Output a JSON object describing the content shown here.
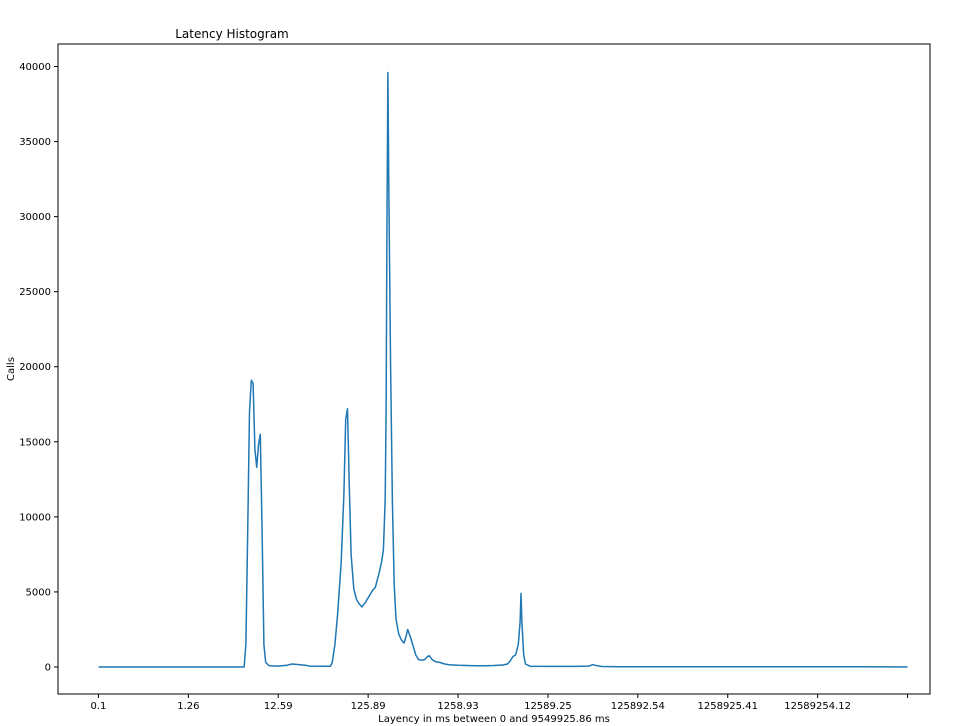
{
  "chart_data": {
    "type": "line",
    "title": "Latency Histogram",
    "xlabel": "Layency in ms between 0 and 9549925.86 ms",
    "ylabel": "Calls",
    "x_tick_labels": [
      "0.1",
      "1.26",
      "12.59",
      "125.89",
      "1258.93",
      "12589.25",
      "125892.54",
      "1258925.41",
      "12589254.12",
      ""
    ],
    "y_ticks": [
      0,
      5000,
      10000,
      15000,
      20000,
      25000,
      30000,
      35000,
      40000
    ],
    "ylim": [
      -1800,
      41500
    ],
    "xlim": [
      -0.45,
      9.25
    ],
    "grid": false,
    "legend": "none",
    "series": [
      {
        "color": "#1f77b4",
        "points": [
          [
            0.0,
            0
          ],
          [
            1.0,
            0
          ],
          [
            1.5,
            0
          ],
          [
            1.58,
            0
          ],
          [
            1.62,
            0
          ],
          [
            1.64,
            1500
          ],
          [
            1.66,
            9000
          ],
          [
            1.68,
            17000
          ],
          [
            1.7,
            19100
          ],
          [
            1.72,
            18900
          ],
          [
            1.74,
            14500
          ],
          [
            1.76,
            13300
          ],
          [
            1.78,
            14800
          ],
          [
            1.8,
            15500
          ],
          [
            1.82,
            9000
          ],
          [
            1.84,
            1500
          ],
          [
            1.86,
            300
          ],
          [
            1.9,
            80
          ],
          [
            2.0,
            60
          ],
          [
            2.1,
            120
          ],
          [
            2.15,
            200
          ],
          [
            2.2,
            170
          ],
          [
            2.3,
            120
          ],
          [
            2.35,
            60
          ],
          [
            2.5,
            50
          ],
          [
            2.58,
            50
          ],
          [
            2.6,
            300
          ],
          [
            2.63,
            1500
          ],
          [
            2.66,
            3500
          ],
          [
            2.7,
            7000
          ],
          [
            2.73,
            11500
          ],
          [
            2.75,
            16500
          ],
          [
            2.77,
            17200
          ],
          [
            2.79,
            12000
          ],
          [
            2.81,
            7500
          ],
          [
            2.84,
            5200
          ],
          [
            2.87,
            4500
          ],
          [
            2.9,
            4200
          ],
          [
            2.93,
            4000
          ],
          [
            2.97,
            4300
          ],
          [
            3.0,
            4600
          ],
          [
            3.05,
            5100
          ],
          [
            3.08,
            5300
          ],
          [
            3.12,
            6200
          ],
          [
            3.15,
            7000
          ],
          [
            3.17,
            7800
          ],
          [
            3.19,
            11200
          ],
          [
            3.2,
            17000
          ],
          [
            3.21,
            30000
          ],
          [
            3.22,
            39600
          ],
          [
            3.23,
            32000
          ],
          [
            3.25,
            20000
          ],
          [
            3.27,
            11000
          ],
          [
            3.29,
            5500
          ],
          [
            3.31,
            3200
          ],
          [
            3.34,
            2200
          ],
          [
            3.37,
            1800
          ],
          [
            3.4,
            1600
          ],
          [
            3.42,
            2000
          ],
          [
            3.44,
            2500
          ],
          [
            3.47,
            2000
          ],
          [
            3.5,
            1400
          ],
          [
            3.53,
            800
          ],
          [
            3.56,
            500
          ],
          [
            3.6,
            450
          ],
          [
            3.63,
            500
          ],
          [
            3.66,
            700
          ],
          [
            3.68,
            750
          ],
          [
            3.71,
            500
          ],
          [
            3.75,
            350
          ],
          [
            3.8,
            300
          ],
          [
            3.85,
            200
          ],
          [
            3.9,
            150
          ],
          [
            4.0,
            120
          ],
          [
            4.1,
            100
          ],
          [
            4.2,
            80
          ],
          [
            4.3,
            80
          ],
          [
            4.4,
            100
          ],
          [
            4.5,
            130
          ],
          [
            4.55,
            200
          ],
          [
            4.58,
            400
          ],
          [
            4.61,
            700
          ],
          [
            4.64,
            800
          ],
          [
            4.67,
            1500
          ],
          [
            4.69,
            3000
          ],
          [
            4.7,
            4900
          ],
          [
            4.71,
            3000
          ],
          [
            4.73,
            800
          ],
          [
            4.75,
            200
          ],
          [
            4.8,
            50
          ],
          [
            5.0,
            40
          ],
          [
            5.3,
            40
          ],
          [
            5.45,
            60
          ],
          [
            5.5,
            150
          ],
          [
            5.55,
            80
          ],
          [
            5.6,
            30
          ],
          [
            5.8,
            20
          ],
          [
            6.5,
            10
          ],
          [
            7.5,
            10
          ],
          [
            8.5,
            10
          ],
          [
            9.0,
            0
          ]
        ]
      }
    ]
  }
}
